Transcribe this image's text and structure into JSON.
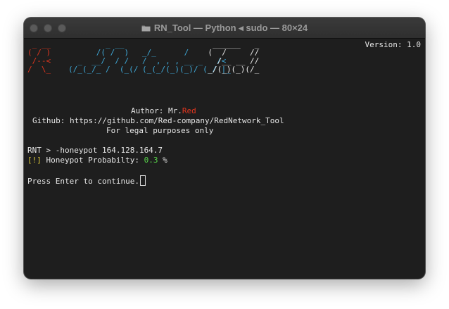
{
  "window": {
    "title": "RN_Tool — Python ◂ sudo — 80×24",
    "icon": "folder-icon"
  },
  "terminal": {
    "version_text": "Version: 1.0",
    "banner": {
      "red_rows": [
        " _ __",
        "( / )",
        " /--<",
        "/  \\_"
      ],
      "mid_rows": [
        "        _ __",
        "      /( /  )",
        "  _  __/  / /",
        "(/_(_/_ /  (_(/"
      ],
      "white_rows": [
        "                ______   _",
        "               (  /     //",
        "                 /__ __ //",
        "               _/(_)(_)(/_"
      ]
    },
    "author_label": "Author: Mr.",
    "author_name": "Red",
    "github_line": "Github: https://github.com/Red-company/RedNetwork_Tool",
    "legal_line": "For legal purposes only",
    "command_line": "RNT > -honeypot 164.128.164.7",
    "result_prefix": "[!]",
    "result_label": " Honeypot Probabilty: ",
    "result_value": "0.3",
    "result_unit": " %",
    "prompt_line": "Press Enter to continue."
  },
  "colors": {
    "accent_red": "#e2361e",
    "accent_cyan": "#3fa9d8",
    "warn_yellow": "#d8c63a",
    "value_green": "#57d34a",
    "background": "#1e1e1e"
  }
}
